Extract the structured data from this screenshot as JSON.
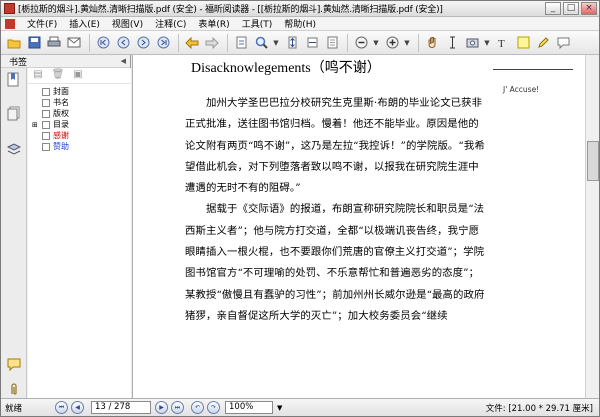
{
  "window": {
    "title": "[栃拉斯的烟斗].黄灿然.清晰扫描版.pdf (安全) - 福昕阅读器 - [[栃拉斯的烟斗].黄灿然.清晰扫描版.pdf (安全)]",
    "minimize": "_",
    "maximize": "□",
    "close": "×"
  },
  "menu": {
    "items": [
      "文件(F)",
      "插入(E)",
      "视图(V)",
      "注释(C)",
      "表单(R)",
      "工具(T)",
      "帮助(H)"
    ]
  },
  "toolbar": {
    "icons": [
      "folder-icon",
      "save-icon",
      "print-icon",
      "email-icon",
      "first-page-icon",
      "prev-page-icon",
      "next-page-icon",
      "last-page-icon",
      "back-icon",
      "forward-icon",
      "rotate-icon",
      "zoom-icon",
      "fit-page-icon",
      "fit-width-icon",
      "actual-size-icon",
      "zoom-out-icon",
      "zoom-in-icon",
      "hand-icon",
      "select-text-icon",
      "snapshot-icon",
      "typewriter-icon",
      "note-icon",
      "highlight-icon",
      "comment-icon"
    ]
  },
  "sidebar": {
    "header": "书签",
    "items": [
      {
        "label": "封面",
        "color": "#000000"
      },
      {
        "label": "书名",
        "color": "#000000"
      },
      {
        "label": "版权",
        "color": "#000000"
      },
      {
        "label": "目录",
        "color": "#000000"
      },
      {
        "label": "感谢",
        "color": "#dd0000"
      },
      {
        "label": "赞助",
        "color": "#1a3fd4"
      }
    ]
  },
  "document": {
    "heading": "Disacknowlegements（鸣不谢）",
    "marginal_text": "J' Accuse!",
    "paragraphs": [
      "加州大学圣巴巴拉分校研究生克里斯·布朗的毕业论文已获非正式批准，送往图书馆归档。慢着！他还不能毕业。原因是他的论文附有两页“鸣不谢”，这乃是左拉“我控诉！”的学院版。“我希望借此机会，对下列堕落者致以鸣不谢，以报我在研究院生涯中遭遇的无时不有的阻碍。”",
      "据载于《交际语》的报道，布朗宣称研究院院长和职员是“法西斯主义者”；他与院方打交道，全都“以极端讥丧告终，我宁愿眼睛插入一根火棍，也不要跟你们荒唐的官僚主义打交道”；学院图书馆官方“不可理喻的处罚、不乐意帮忙和普遍恶劣的态度”；某教授“傲慢且有蠢驴的习性”；前加州州长威尔逊是“最高的政府猪猡，亲自督促这所大学的灭亡”；加大校务委员会“继续"
    ]
  },
  "status": {
    "left": "就绪",
    "page": "13 / 278",
    "zoom": "100%",
    "right": "文件: [21.00 * 29.71 厘米]"
  }
}
